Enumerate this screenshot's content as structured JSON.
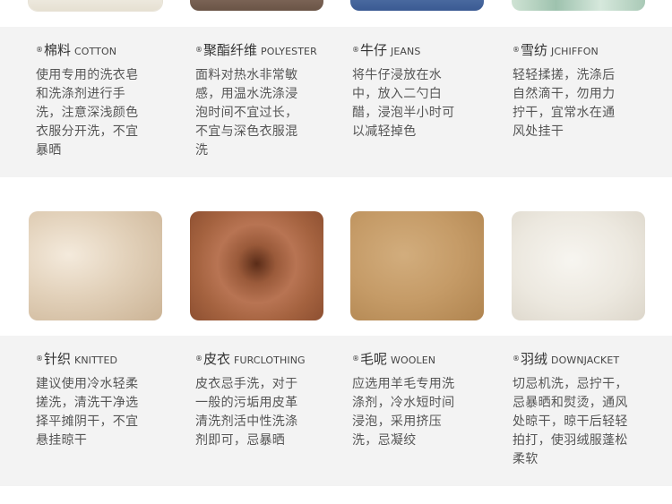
{
  "fabrics": [
    {
      "cn": "棉料",
      "en": "COTTON",
      "desc": [
        "使用专用的洗衣皂",
        "和洗涤剂进行手",
        "洗，注意深浅颜色",
        "衣服分开洗，不宜",
        "暴晒"
      ]
    },
    {
      "cn": "聚酯纤维",
      "en": "POLYESTER",
      "desc": [
        "面料对热水非常敏",
        "感，用温水洗涤浸",
        "泡时间不宜过长，",
        "不宜与深色衣服混",
        "洗"
      ]
    },
    {
      "cn": "牛仔",
      "en": "JEANS",
      "desc": [
        "将牛仔浸放在水",
        "中，放入二勺白",
        "醋，浸泡半小时可",
        "以减轻掉色"
      ]
    },
    {
      "cn": "雪纺",
      "en": "JCHIFFON",
      "desc": [
        "轻轻揉搓，洗涤后",
        "自然滴干，勿用力",
        "拧干，宜常水在通",
        "风处挂干"
      ]
    },
    {
      "cn": "针织",
      "en": "KNITTED",
      "desc": [
        "建议使用冷水轻柔",
        "搓洗，清洗干净选",
        "择平摊阴干，不宜",
        "悬挂晾干"
      ]
    },
    {
      "cn": "皮衣",
      "en": "FURCLOTHING",
      "desc": [
        "皮衣忌手洗，对于",
        "一般的污垢用皮革",
        "清洗剂活中性洗涤",
        "剂即可，忌暴晒"
      ]
    },
    {
      "cn": "毛呢",
      "en": "WOOLEN",
      "desc": [
        "应选用羊毛专用洗",
        "涤剂，冷水短时间",
        "浸泡，采用挤压",
        "洗，忌凝绞"
      ]
    },
    {
      "cn": "羽绒",
      "en": "DOWNJACKET",
      "desc": [
        "切忌机洗，忌拧干，",
        "忌暴晒和熨烫，通风",
        "处晾干，晾干后轻轻",
        "拍打，使羽绒服蓬松",
        "柔软"
      ]
    }
  ],
  "mark": "®",
  "colors": {
    "band": "#f3f3f3",
    "heading": "#333333",
    "body": "#555555"
  }
}
